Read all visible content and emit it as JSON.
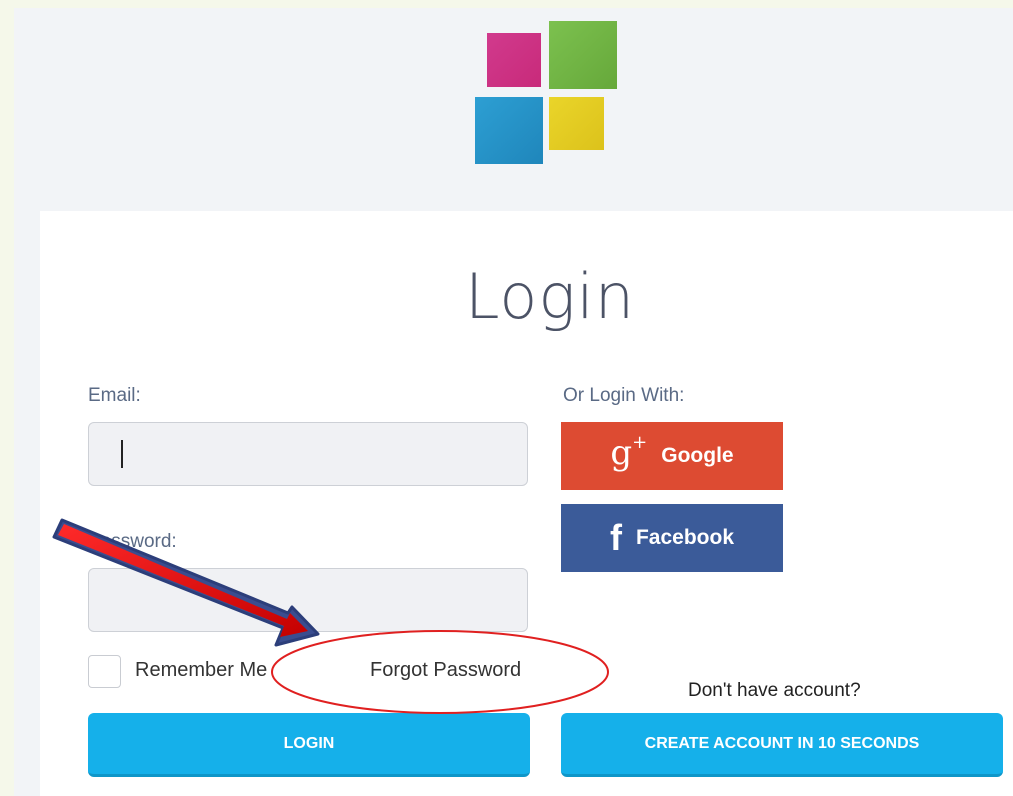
{
  "heading": {
    "title": "Login"
  },
  "form": {
    "email_label": "Email:",
    "password_label": "Password:",
    "remember_label": "Remember Me",
    "forgot_label": "Forgot Password",
    "login_button": "LOGIN"
  },
  "social": {
    "label": "Or Login With:",
    "google": {
      "glyph": "g",
      "plus": "+",
      "label": "Google",
      "color": "#dd4b32",
      "icon": "google-plus-icon"
    },
    "facebook": {
      "glyph": "f",
      "label": "Facebook",
      "color": "#3b5b99",
      "icon": "facebook-icon"
    }
  },
  "signup": {
    "prompt": "Don't have account?",
    "button": "CREATE ACCOUNT IN 10 SECONDS"
  },
  "colors": {
    "primary_button": "#15b0ea",
    "logo": [
      "#c82a7a",
      "#66a83a",
      "#1f86bb",
      "#dcc21b"
    ],
    "annotation_arrow": "#e02020",
    "annotation_circle": "#e02020"
  }
}
